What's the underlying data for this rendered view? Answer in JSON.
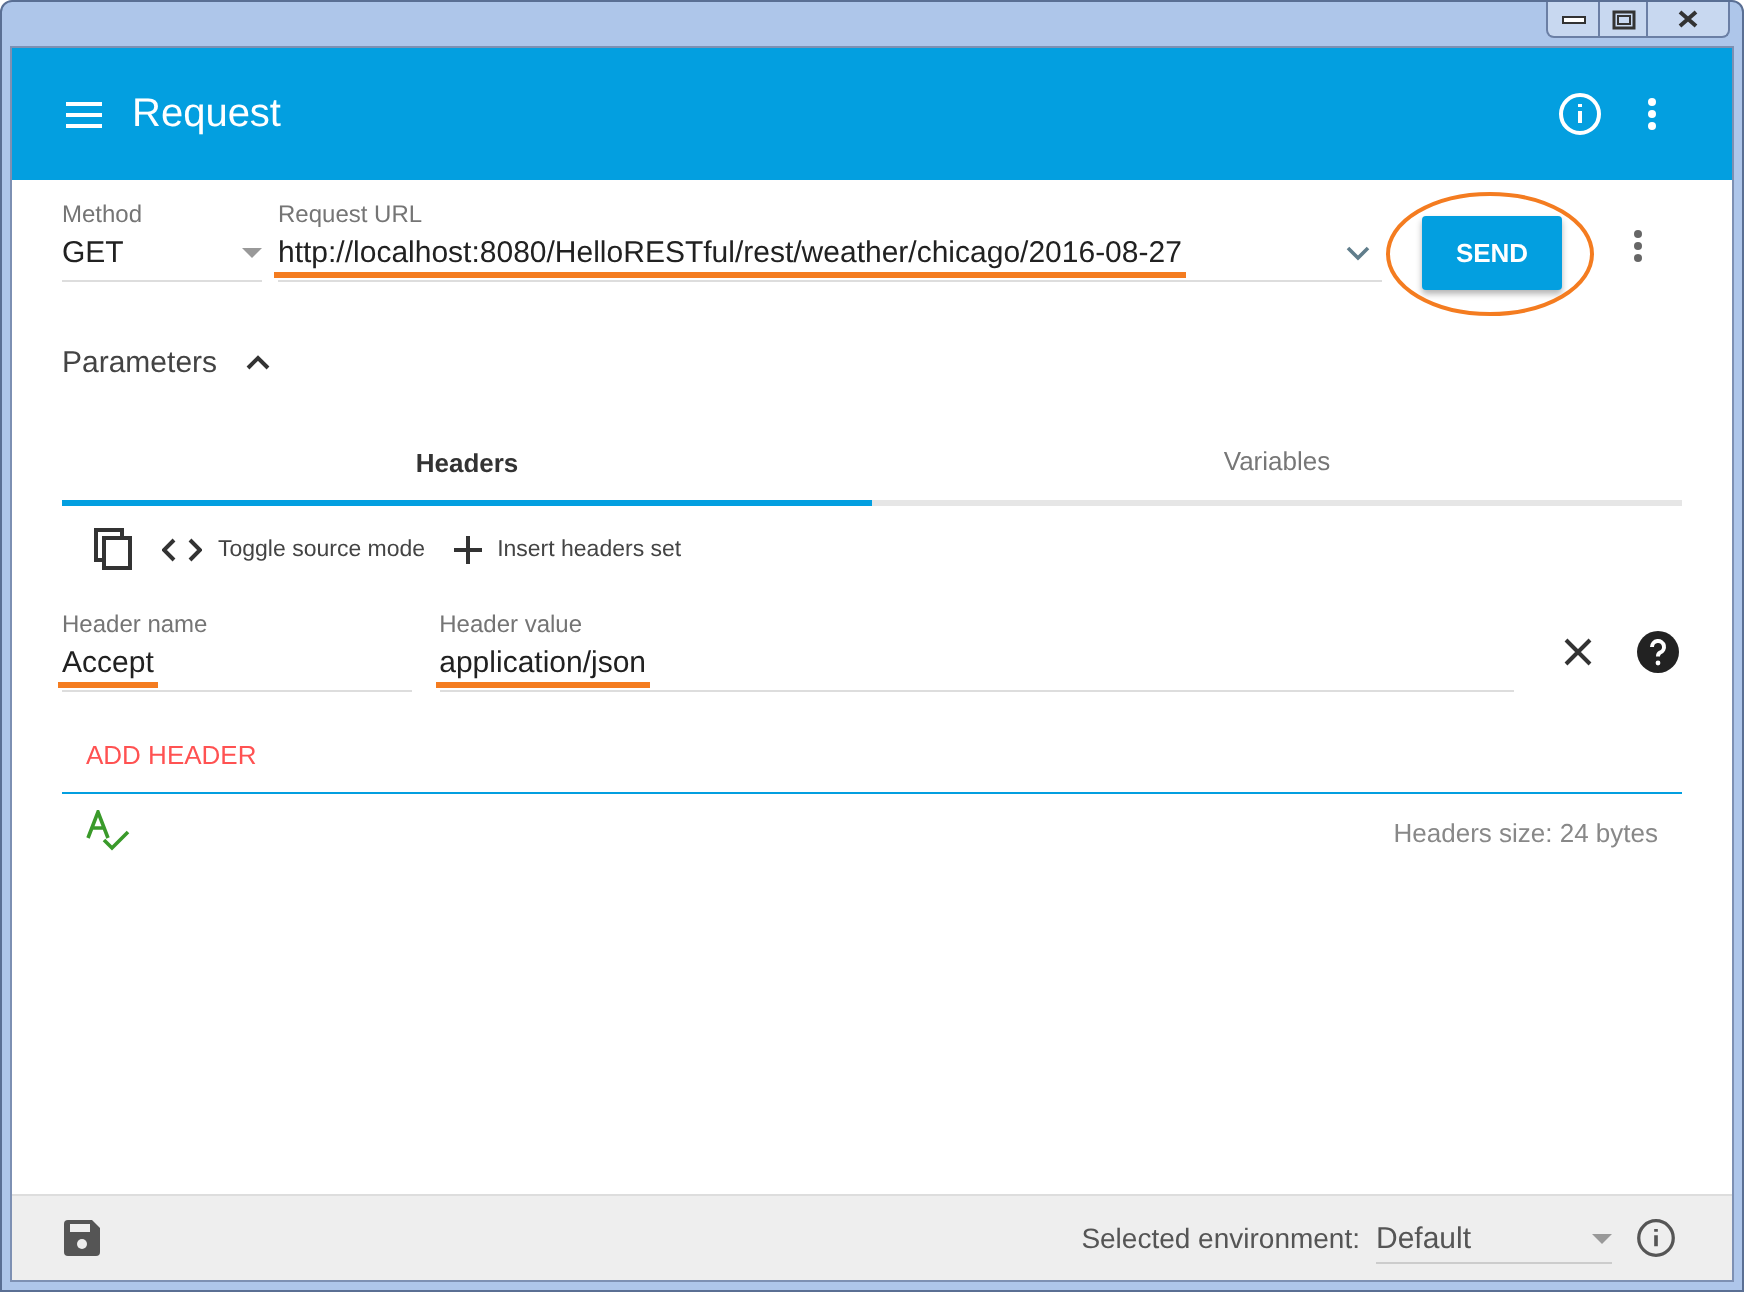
{
  "app_bar": {
    "title": "Request"
  },
  "method": {
    "label": "Method",
    "value": "GET"
  },
  "url": {
    "label": "Request URL",
    "value": "http://localhost:8080/HelloRESTful/rest/weather/chicago/2016-08-27",
    "highlighted": true
  },
  "send_button": {
    "label": "SEND",
    "circled": true
  },
  "parameters": {
    "label": "Parameters",
    "expanded": true
  },
  "tabs": [
    {
      "label": "Headers",
      "selected": true
    },
    {
      "label": "Variables",
      "selected": false
    }
  ],
  "toolbar": [
    {
      "kind": "copy"
    },
    {
      "kind": "code",
      "label": "Toggle source mode"
    },
    {
      "kind": "plus",
      "label": "Insert headers set"
    }
  ],
  "headers": [
    {
      "name_label": "Header name",
      "name": "Accept",
      "value_label": "Header value",
      "value": "application/json",
      "highlighted": true
    }
  ],
  "add_header": "ADD HEADER",
  "headers_size": "Headers size: 24 bytes",
  "footer": {
    "env_label": "Selected environment:",
    "env_value": "Default"
  }
}
